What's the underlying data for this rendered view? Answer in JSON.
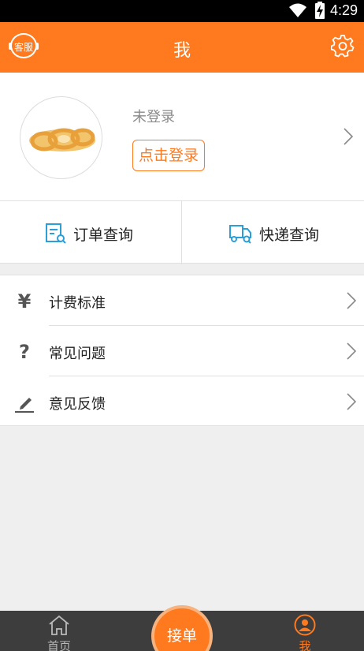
{
  "status_bar": {
    "time": "4:29"
  },
  "header": {
    "title": "我",
    "customer_service_label": "客服"
  },
  "profile": {
    "login_status": "未登录",
    "login_button": "点击登录"
  },
  "quick_actions": [
    {
      "label": "订单查询",
      "icon": "order-search-icon"
    },
    {
      "label": "快递查询",
      "icon": "delivery-truck-icon"
    }
  ],
  "menu": [
    {
      "label": "计费标准",
      "icon": "yen-icon",
      "glyph": "¥"
    },
    {
      "label": "常见问题",
      "icon": "question-icon",
      "glyph": "?"
    },
    {
      "label": "意见反馈",
      "icon": "pencil-icon"
    }
  ],
  "tabbar": {
    "home": "首页",
    "center": "接单",
    "me": "我"
  },
  "colors": {
    "accent": "#ff7a1f",
    "tabbar_bg": "#3d3d3d",
    "page_bg": "#efefef"
  }
}
